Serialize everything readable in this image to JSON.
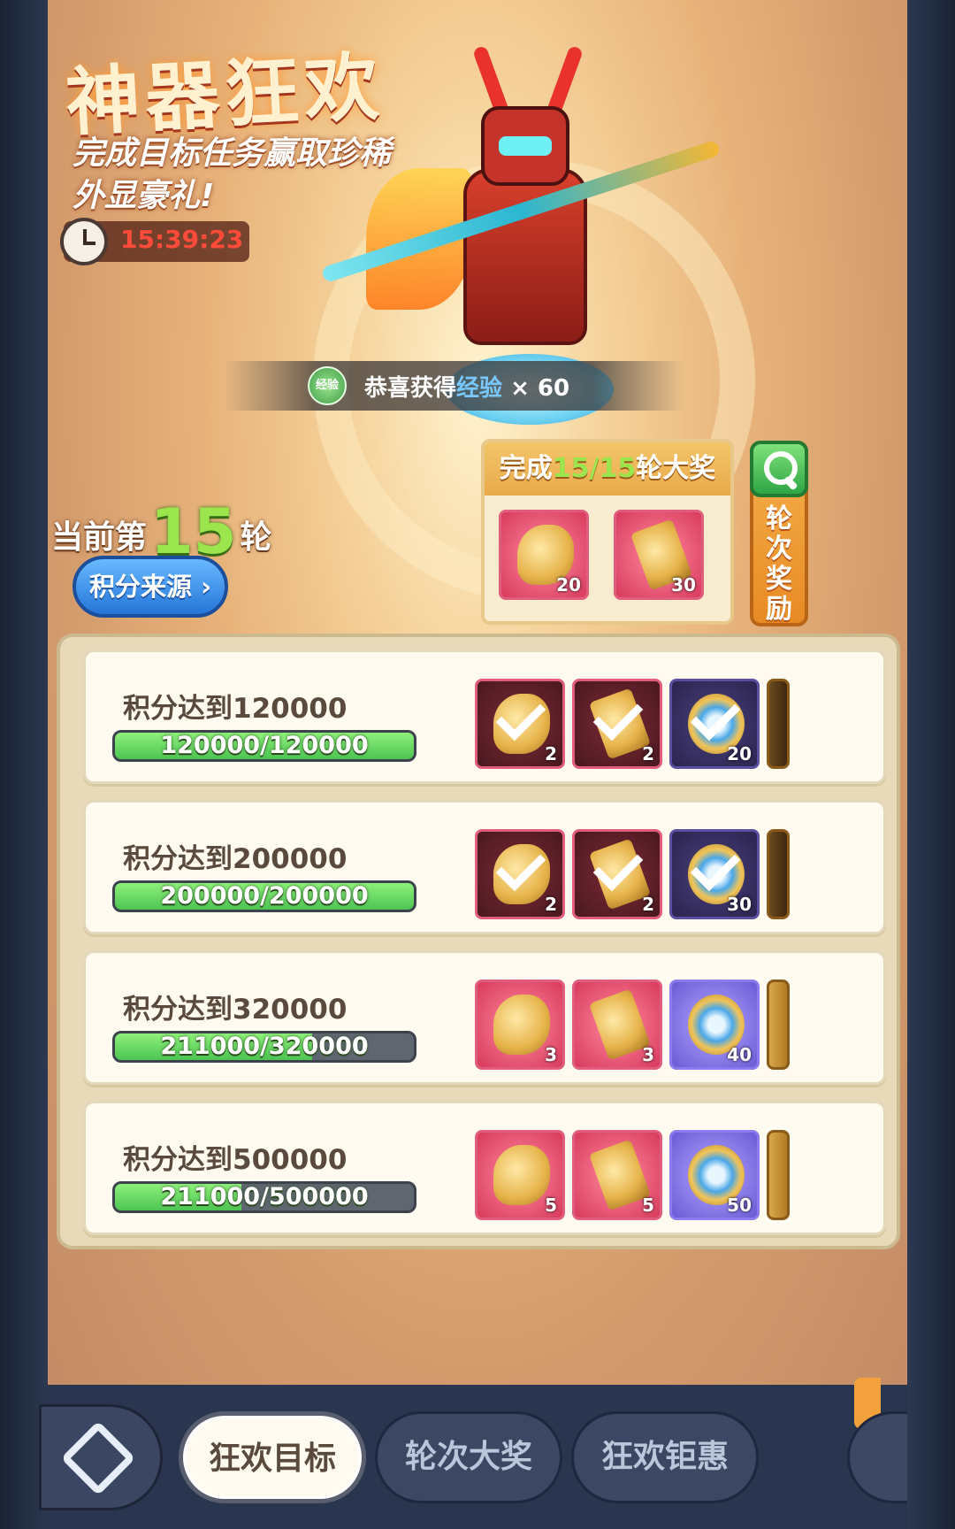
{
  "header": {
    "title": "神器狂欢",
    "subtitle": "完成目标任务赢取珍稀外显豪礼!",
    "timer": "15:39:23"
  },
  "toast": {
    "icon_label": "经验",
    "prefix": "恭喜获得",
    "highlight": "经验",
    "suffix": "× 60"
  },
  "round": {
    "prefix": "当前第",
    "number": "15",
    "suffix": "轮",
    "score_source_label": "积分来源"
  },
  "grand_prize": {
    "prefix": "完成",
    "progress": "15/15",
    "suffix": "轮大奖",
    "items": [
      {
        "icon": "golden-medal-icon",
        "qty": "20"
      },
      {
        "icon": "hammer-icon",
        "qty": "30"
      }
    ]
  },
  "round_reward_button": {
    "label": "轮次奖励",
    "icon": "search-icon"
  },
  "tasks": [
    {
      "label": "积分达到120000",
      "progress_text": "120000/120000",
      "progress_fraction": 1.0,
      "rewards": [
        {
          "icon": "golden-wing-icon",
          "qty": "2",
          "claimed": true,
          "style": "pink"
        },
        {
          "icon": "hammer-icon",
          "qty": "2",
          "claimed": true,
          "style": "pink"
        },
        {
          "icon": "golden-disc-icon",
          "qty": "20",
          "claimed": true,
          "style": "purple"
        }
      ]
    },
    {
      "label": "积分达到200000",
      "progress_text": "200000/200000",
      "progress_fraction": 1.0,
      "rewards": [
        {
          "icon": "golden-wing-icon",
          "qty": "2",
          "claimed": true,
          "style": "pink"
        },
        {
          "icon": "hammer-icon",
          "qty": "2",
          "claimed": true,
          "style": "pink"
        },
        {
          "icon": "golden-disc-icon",
          "qty": "30",
          "claimed": true,
          "style": "purple"
        }
      ]
    },
    {
      "label": "积分达到320000",
      "progress_text": "211000/320000",
      "progress_fraction": 0.659,
      "rewards": [
        {
          "icon": "mystery-wing-icon",
          "qty": "3",
          "claimed": false,
          "style": "pink"
        },
        {
          "icon": "hammer-icon",
          "qty": "3",
          "claimed": false,
          "style": "pink"
        },
        {
          "icon": "golden-disc-icon",
          "qty": "40",
          "claimed": false,
          "style": "purple"
        }
      ]
    },
    {
      "label": "积分达到500000",
      "progress_text": "211000/500000",
      "progress_fraction": 0.422,
      "rewards": [
        {
          "icon": "mystery-wing-icon",
          "qty": "5",
          "claimed": false,
          "style": "pink"
        },
        {
          "icon": "hammer-icon",
          "qty": "5",
          "claimed": false,
          "style": "pink"
        },
        {
          "icon": "golden-disc-icon",
          "qty": "50",
          "claimed": false,
          "style": "purple"
        }
      ]
    }
  ],
  "tabs": [
    {
      "label": "狂欢目标",
      "active": true
    },
    {
      "label": "轮次大奖",
      "active": false
    },
    {
      "label": "狂欢钜惠",
      "active": false
    }
  ],
  "colors": {
    "progress_green": "#4cc553",
    "highlight_green": "#9be64c",
    "timer_red": "#ff4b3a",
    "toast_blue": "#79c8ff"
  }
}
